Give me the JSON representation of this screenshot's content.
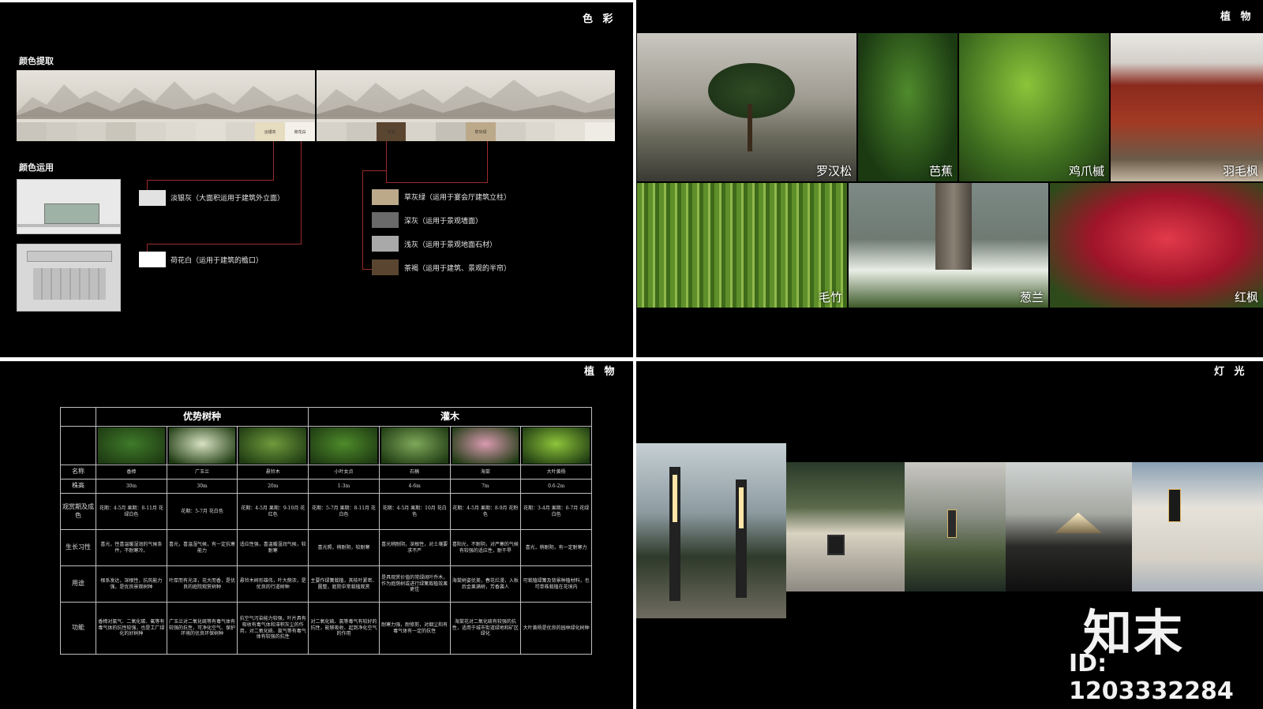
{
  "color_panel": {
    "title": "色 彩",
    "extract_label": "颜色提取",
    "usage_label": "颜色运用",
    "swatches_left": [
      "",
      "",
      "",
      "",
      "",
      "",
      "",
      "",
      "淡银灰",
      "荷花白"
    ],
    "swatches_right": [
      "",
      "",
      "茶褐",
      "",
      "",
      "草灰绿",
      "",
      "",
      "",
      ""
    ],
    "left_items": [
      {
        "text": "淡银灰（大面积运用于建筑外立面）",
        "color": "#e2e2e2"
      },
      {
        "text": "荷花白（运用于建筑的檐口）",
        "color": "#ffffff"
      }
    ],
    "right_items": [
      {
        "text": "草灰绿（运用于宴会厅建筑立柱）",
        "color": "#bba98a"
      },
      {
        "text": "深灰（运用于景观墙面）",
        "color": "#6a6a6a"
      },
      {
        "text": "浅灰（运用于景观地面石材）",
        "color": "#a9a9a9"
      },
      {
        "text": "茶褐（运用于建筑、景观的半帘）",
        "color": "#5a4530"
      }
    ]
  },
  "plants_panel": {
    "title": "植 物",
    "photos": [
      "罗汉松",
      "芭蕉",
      "鸡爪槭",
      "羽毛枫",
      "毛竹",
      "葱兰",
      "红枫"
    ]
  },
  "table_panel": {
    "title": "植 物",
    "group_1": "优势树种",
    "group_2": "灌木",
    "row_labels": [
      "名称",
      "株高",
      "观赏期及成色",
      "生长习性",
      "用途",
      "功能"
    ],
    "species": [
      {
        "name": "香樟",
        "height": "30m",
        "season": "花期：4-5月 果期：8-11月 花绿白色",
        "habit": "喜光，性喜温暖湿润的气候条件，不耐寒冷。",
        "use": "根系发达，深根性，抗风能力强，是优良景观树种",
        "function": "香樟对氯气、二氧化碳、氟等有毒气体的抗性较强，也是工厂绿化的好树种"
      },
      {
        "name": "广玉兰",
        "height": "30m",
        "season": "花期：5-7月 花白色",
        "habit": "喜光，喜温湿气候，有一定抗寒能力",
        "use": "叶厚而有光泽，花大而香，是优良的庭院观赏树种",
        "function": "广玉兰对二氧化硫等有毒气体有较强的抗性，可净化空气、保护环境的优良环保树种"
      },
      {
        "name": "悬铃木",
        "height": "20m",
        "season": "花期：4-5月 果期：9-10月 花红色",
        "habit": "适应性强，喜温暖湿润气候，较耐寒",
        "use": "悬铃木树形雄伟，叶大荫浓，是优良的行道树种",
        "function": "抗空气污染能力较强，叶片具有吸收有毒气体和滞积灰尘的作用，对二氧化硫、氯气等有毒气体有较强的抗性"
      },
      {
        "name": "小叶女贞",
        "height": "1-3m",
        "season": "花期：5-7月 果期：8-11月 花白色",
        "habit": "喜光照，稍耐阴，较耐寒",
        "use": "主要作绿篱栽植，其枝叶紧密、圆整，庭院中常栽植观赏",
        "function": "对二氧化硫、氯等毒气有较好的抗性，能够吸收、起到净化空气的作用"
      },
      {
        "name": "石楠",
        "height": "4-6m",
        "season": "花期：4-5月 果期：10月 花白色",
        "habit": "喜光稍耐阴，深根性，对土壤要求不严",
        "use": "是具观赏价值的常绿阔叶乔木，作为庭荫树或进行绿篱栽植效果更佳",
        "function": "耐寒力强，耐修剪，对烟尘和有毒气体有一定的抗性"
      },
      {
        "name": "海棠",
        "height": "7m",
        "season": "花期：4-5月 果期：8-9月 花粉色",
        "habit": "喜阳光，不耐阴，对严寒的气候有较强的适应性，耐干旱",
        "use": "海棠树姿优美，春花烂漫，入秋后金果满树，芳香袭人",
        "function": "海棠花对二氧化硫有较强的抗性，适用于城市街道绿地和矿区绿化"
      },
      {
        "name": "大叶黄杨",
        "height": "0.6-2m",
        "season": "花期：3-4月 果期：6-7月 花绿白色",
        "habit": "喜光，稍耐阴，有一定耐寒力",
        "use": "可栽植绿篱及背景种植材料，也可单株栽植在花境内",
        "function": "大叶黄杨是优良的园林绿化树种"
      }
    ],
    "thumb_colors": [
      "#3f7a2a",
      "#d7e2c2",
      "#6f9a3c",
      "#4e8a2a",
      "#7fa85a",
      "#d99ab0",
      "#8ec43a"
    ]
  },
  "light_panel": {
    "title": "灯 光"
  },
  "watermark": {
    "brand": "知末",
    "id": "ID: 1203332284"
  }
}
